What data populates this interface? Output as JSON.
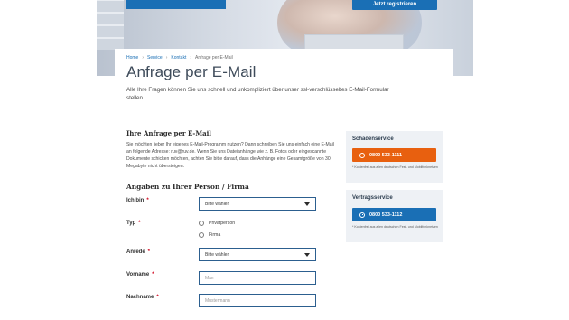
{
  "hero": {
    "cta_label": "Jetzt registrieren"
  },
  "breadcrumb": [
    {
      "label": "Home"
    },
    {
      "label": "Service"
    },
    {
      "label": "Kontakt"
    },
    {
      "label": "Anfrage per E-Mail"
    }
  ],
  "breadcrumb_sep": "›",
  "page": {
    "title": "Anfrage per E-Mail",
    "intro": "Alle Ihre Fragen können Sie uns schnell und unkompliziert über unser ssl-verschlüsseltes E-Mail-Formular stellen."
  },
  "request": {
    "heading": "Ihre Anfrage per E-Mail",
    "text": "Sie möchten lieber Ihr eigenes E-Mail-Programm nutzen? Dann schreiben Sie uns einfach eine E-Mail an folgende Adresse: ruv@ruv.de. Wenn Sie uns Dateianhänge wie z. B. Fotos oder eingescannte Dokumente schicken möchten, achten Sie bitte darauf, dass die Anhänge eine Gesamtgröße von 30 Megabyte nicht übersteigen."
  },
  "form": {
    "heading": "Angaben zu Ihrer Person / Firma",
    "required_mark": "*",
    "ich_bin": {
      "label": "Ich bin",
      "value": "Bitte wählen"
    },
    "typ": {
      "label": "Typ",
      "options": [
        "Privatperson",
        "Firma"
      ]
    },
    "anrede": {
      "label": "Anrede",
      "value": "Bitte wählen"
    },
    "vorname": {
      "label": "Vorname",
      "placeholder": "Max"
    },
    "nachname": {
      "label": "Nachname",
      "placeholder": "Mustermann"
    }
  },
  "sidebar": {
    "schaden": {
      "title": "Schadenservice",
      "phone": "0800 533-1111",
      "note": "* Kostenfrei aus allen deutschen Fest- und Mobilfunknetzen",
      "color": "#e8600f"
    },
    "vertrag": {
      "title": "Vertragsservice",
      "phone": "0800 533-1112",
      "note": "* Kostenfrei aus allen deutschen Fest- und Mobilfunknetzen",
      "color": "#1a6fb5"
    }
  },
  "colors": {
    "accent": "#1a6fb5",
    "orange": "#e8600f",
    "title": "#3e4b5a"
  }
}
